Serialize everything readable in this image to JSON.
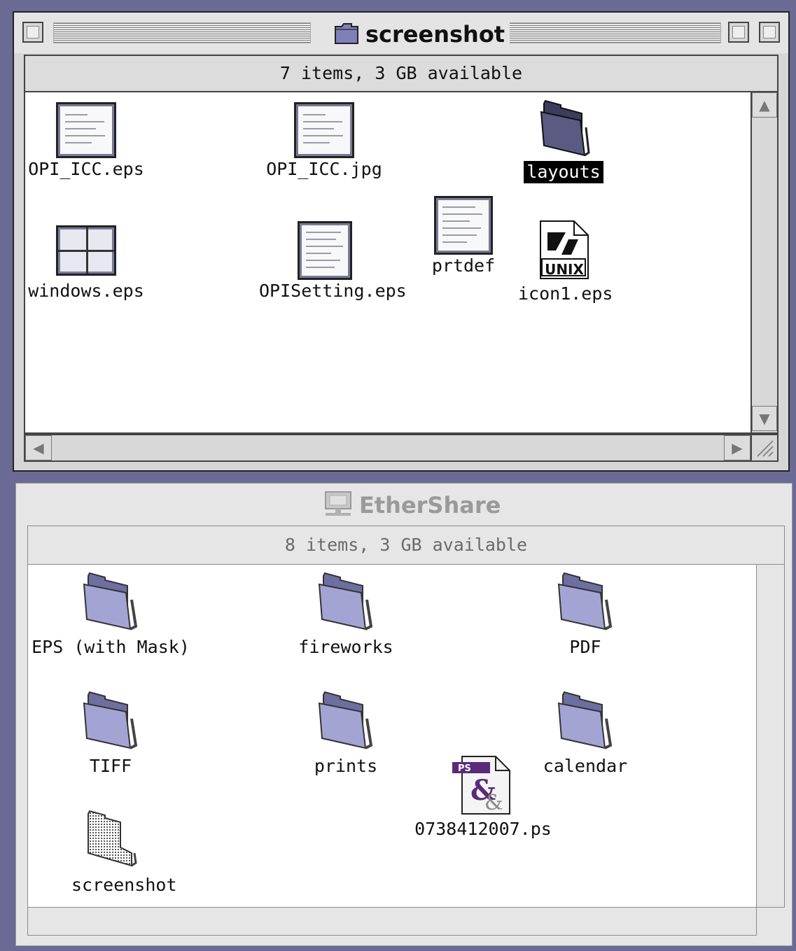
{
  "windows": {
    "top": {
      "title": "screenshot",
      "info": "7 items, 3 GB available",
      "items": [
        {
          "label": "OPI_ICC.eps",
          "icon": "eps-document-icon",
          "selected": false
        },
        {
          "label": "OPI_ICC.jpg",
          "icon": "jpg-document-icon",
          "selected": false
        },
        {
          "label": "layouts",
          "icon": "folder-icon",
          "selected": true
        },
        {
          "label": "windows.eps",
          "icon": "eps-document-icon",
          "selected": false
        },
        {
          "label": "OPISetting.eps",
          "icon": "eps-document-icon",
          "selected": false
        },
        {
          "label": "prtdef",
          "icon": "document-icon",
          "selected": false
        },
        {
          "label": "icon1.eps",
          "icon": "unix-document-icon",
          "selected": false
        }
      ],
      "unix_badge": "UNIX"
    },
    "bottom": {
      "title": "EtherShare",
      "info": "8 items, 3 GB available",
      "items": [
        {
          "label": "EPS (with Mask)",
          "icon": "folder-icon"
        },
        {
          "label": "fireworks",
          "icon": "folder-icon"
        },
        {
          "label": "PDF",
          "icon": "folder-icon"
        },
        {
          "label": "TIFF",
          "icon": "folder-icon"
        },
        {
          "label": "prints",
          "icon": "folder-icon"
        },
        {
          "label": "calendar",
          "icon": "folder-icon"
        },
        {
          "label": "0738412007.ps",
          "icon": "postscript-document-icon"
        },
        {
          "label": "screenshot",
          "icon": "folder-alias-icon"
        }
      ],
      "ps_badge": "PS"
    }
  },
  "colors": {
    "desktop": "#6a6a94",
    "folder": "#9a9ad0",
    "folder_dark": "#55557a",
    "selection": "#000000"
  }
}
